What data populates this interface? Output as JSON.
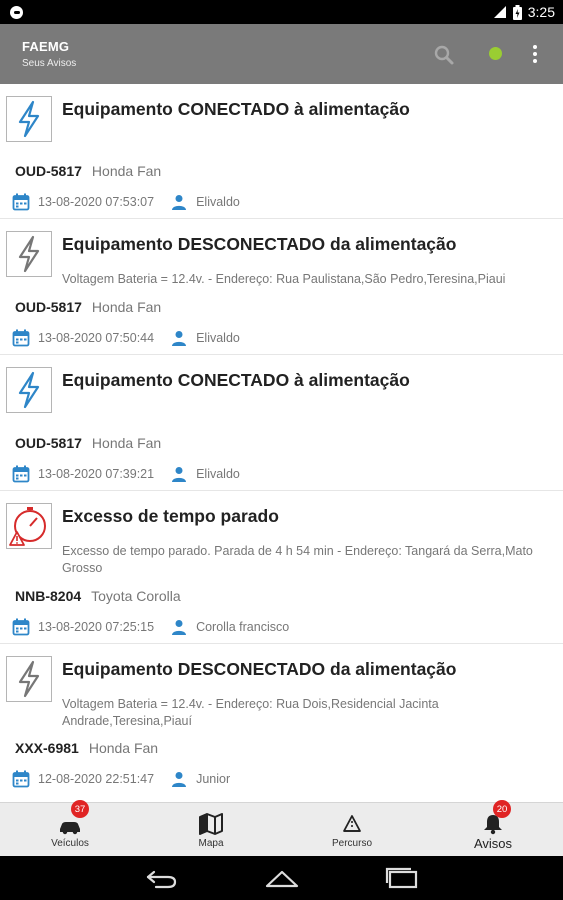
{
  "status_bar": {
    "time": "3:25"
  },
  "app_bar": {
    "title": "FAEMG",
    "subtitle": "Seus Avisos"
  },
  "alerts": [
    {
      "icon": "power-bolt-icon",
      "title": "Equipamento CONECTADO à alimentação",
      "description": "",
      "plate": "OUD-5817",
      "model": "Honda Fan",
      "datetime": "13-08-2020 07:53:07",
      "driver": "Elivaldo"
    },
    {
      "icon": "power-bolt-icon",
      "title": "Equipamento DESCONECTADO da alimentação",
      "description": "Voltagem Bateria = 12.4v. - Endereço: Rua Paulistana,São Pedro,Teresina,Piaui",
      "plate": "OUD-5817",
      "model": "Honda Fan",
      "datetime": "13-08-2020 07:50:44",
      "driver": "Elivaldo"
    },
    {
      "icon": "power-bolt-icon",
      "title": "Equipamento CONECTADO à alimentação",
      "description": "",
      "plate": "OUD-5817",
      "model": "Honda Fan",
      "datetime": "13-08-2020 07:39:21",
      "driver": "Elivaldo"
    },
    {
      "icon": "stopwatch-warning-icon",
      "title": "Excesso de tempo parado",
      "description": "Excesso de tempo parado. Parada de 4 h 54 min  - Endereço: Tangará da Serra,Mato Grosso",
      "plate": "NNB-8204",
      "model": "Toyota Corolla",
      "datetime": "13-08-2020 07:25:15",
      "driver": "Corolla francisco"
    },
    {
      "icon": "power-bolt-icon",
      "title": "Equipamento DESCONECTADO da alimentação",
      "description": "Voltagem Bateria = 12.4v. - Endereço: Rua Dois,Residencial Jacinta Andrade,Teresina,Piauí",
      "plate": "XXX-6981",
      "model": "Honda Fan",
      "datetime": "12-08-2020 22:51:47",
      "driver": "Junior"
    }
  ],
  "bottom_nav": [
    {
      "label": "Veículos",
      "icon": "car-icon",
      "badge": "37"
    },
    {
      "label": "Mapa",
      "icon": "map-icon",
      "badge": ""
    },
    {
      "label": "Percurso",
      "icon": "route-icon",
      "badge": ""
    },
    {
      "label": "Avisos",
      "icon": "bell-icon",
      "badge": "20"
    }
  ],
  "colors": {
    "app_bar": "#7a7a7a",
    "accent_blue": "#2e86c8",
    "badge_red": "#e02424",
    "gps_green": "#9acd32"
  }
}
